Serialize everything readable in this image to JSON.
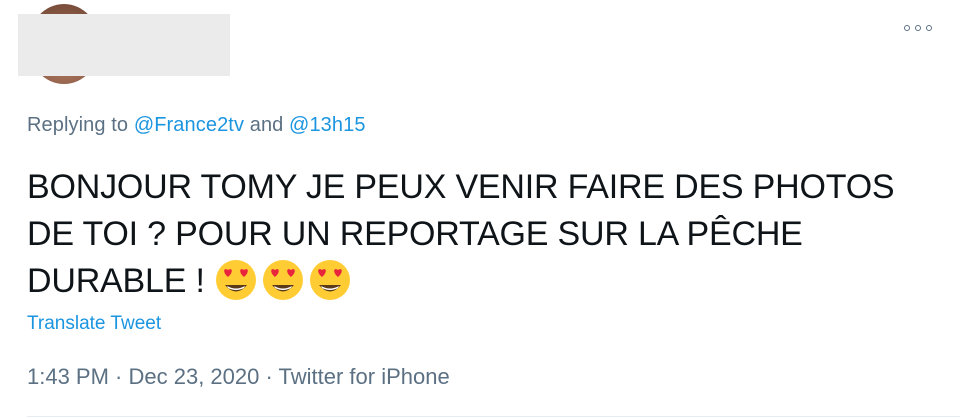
{
  "header": {
    "more_icon": "more-horizontal-icon"
  },
  "reply": {
    "prefix": "Replying to ",
    "handle1": "@France2tv",
    "conjunction": " and ",
    "handle2": "@13h15"
  },
  "tweet": {
    "text": "BONJOUR TOMY JE PEUX VENIR FAIRE DES PHOTOS DE TOI ? POUR UN REPORTAGE SUR LA PÊCHE DURABLE ! ",
    "emojis": [
      "smiling-face-heart-eyes-icon",
      "smiling-face-heart-eyes-icon",
      "smiling-face-heart-eyes-icon"
    ]
  },
  "translate_label": "Translate Tweet",
  "meta": {
    "time": "1:43 PM",
    "sep1": " · ",
    "date": "Dec 23, 2020",
    "sep2": " · ",
    "source": "Twitter for iPhone"
  },
  "colors": {
    "link": "#1b95e0",
    "secondary": "#5b7083",
    "text": "#0f1419"
  }
}
